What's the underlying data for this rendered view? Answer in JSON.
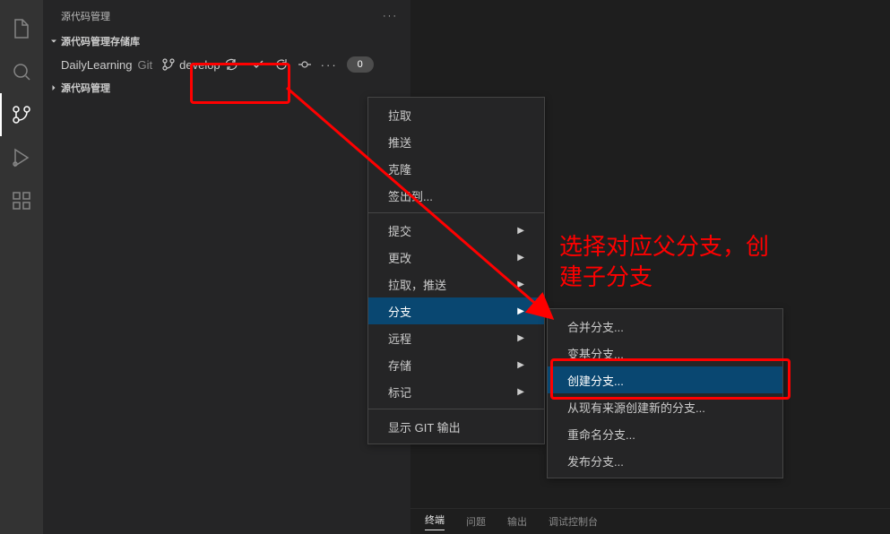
{
  "sidebar": {
    "title": "源代码管理",
    "sections": {
      "repos_header": "源代码管理存储库",
      "scm_header": "源代码管理"
    },
    "repo": {
      "name": "DailyLearning",
      "type": "Git",
      "branch": "develop",
      "sync_icon": "sync-icon",
      "pending_count": "0"
    }
  },
  "menu1": {
    "items": [
      {
        "label": "拉取",
        "has_submenu": false
      },
      {
        "label": "推送",
        "has_submenu": false
      },
      {
        "label": "克隆",
        "has_submenu": false
      },
      {
        "label": "签出到...",
        "has_submenu": false
      }
    ],
    "items2": [
      {
        "label": "提交",
        "has_submenu": true
      },
      {
        "label": "更改",
        "has_submenu": true
      },
      {
        "label": "拉取，推送",
        "has_submenu": true
      },
      {
        "label": "分支",
        "has_submenu": true,
        "hover": true
      },
      {
        "label": "远程",
        "has_submenu": true
      },
      {
        "label": "存储",
        "has_submenu": true
      },
      {
        "label": "标记",
        "has_submenu": true
      }
    ],
    "items3": [
      {
        "label": "显示 GIT 输出",
        "has_submenu": false
      }
    ]
  },
  "menu2": {
    "items": [
      {
        "label": "合并分支..."
      },
      {
        "label": "变基分支..."
      },
      {
        "label": "创建分支...",
        "hover": true
      },
      {
        "label": "从现有来源创建新的分支..."
      },
      {
        "label": "重命名分支..."
      },
      {
        "label": "发布分支..."
      }
    ]
  },
  "annotation": {
    "line1": "选择对应父分支，创",
    "line2": "建子分支"
  },
  "bottom_tabs": {
    "t1": "终端",
    "t2": "问题",
    "t3": "输出",
    "t4": "调试控制台"
  },
  "colors": {
    "highlight": "#ff0000",
    "menu_hover_bg": "#094771"
  }
}
